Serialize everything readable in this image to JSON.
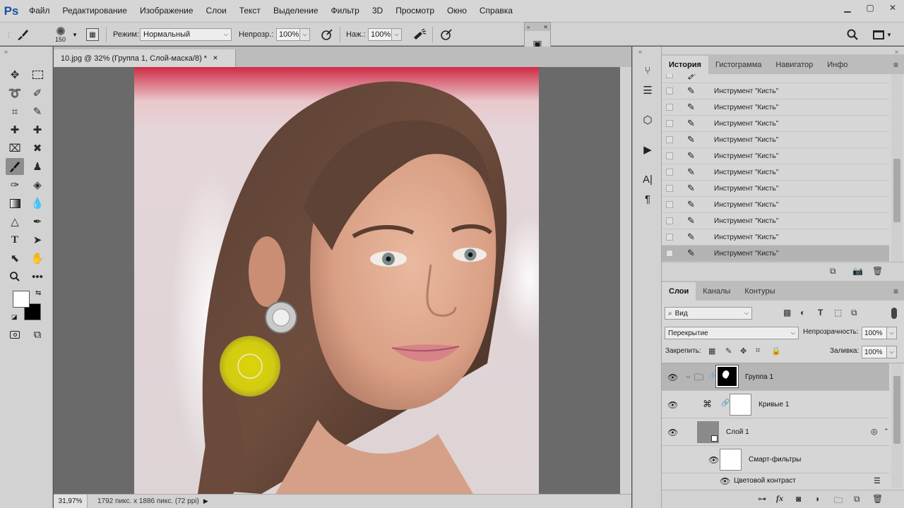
{
  "app": {
    "logo": "Ps"
  },
  "menu": [
    "Файл",
    "Редактирование",
    "Изображение",
    "Слои",
    "Текст",
    "Выделение",
    "Фильтр",
    "3D",
    "Просмотр",
    "Окно",
    "Справка"
  ],
  "options": {
    "brush_size": "150",
    "mode_label": "Режим:",
    "mode_value": "Нормальный",
    "opacity_label": "Непрозр.:",
    "opacity_value": "100%",
    "flow_label": "Наж.:",
    "flow_value": "100%"
  },
  "document": {
    "tab_title": "10.jpg @ 32% (Группа 1, Слой-маска/8) *",
    "zoom": "31,97%",
    "size_info": "1792 пикс. x 1886 пикс. (72 ppi)"
  },
  "history_panel": {
    "tabs": [
      "История",
      "Гистограмма",
      "Навигатор",
      "Инфо"
    ],
    "items": [
      "Инструмент \"Кисть\"",
      "Инструмент \"Кисть\"",
      "Инструмент \"Кисть\"",
      "Инструмент \"Кисть\"",
      "Инструмент \"Кисть\"",
      "Инструмент \"Кисть\"",
      "Инструмент \"Кисть\"",
      "Инструмент \"Кисть\"",
      "Инструмент \"Кисть\"",
      "Инструмент \"Кисть\"",
      "Инструмент \"Кисть\""
    ]
  },
  "layers_panel": {
    "tabs": [
      "Слои",
      "Каналы",
      "Контуры"
    ],
    "filter_kind": "Вид",
    "blend_mode": "Перекрытие",
    "opacity_label": "Непрозрачность:",
    "opacity_value": "100%",
    "lock_label": "Закрепить:",
    "fill_label": "Заливка:",
    "fill_value": "100%",
    "layers": {
      "group": "Группа 1",
      "curves": "Кривые 1",
      "layer1": "Слой 1",
      "smart_filters": "Смарт-фильтры",
      "color_contrast": "Цветовой контраст"
    }
  },
  "colors": {
    "accent": "#1b4fa0",
    "brush_cursor": "#d8d200"
  }
}
